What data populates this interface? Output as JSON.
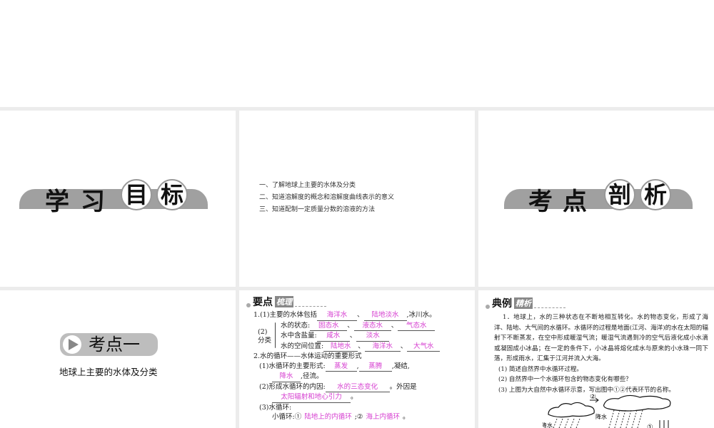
{
  "slides": [
    {
      "title_chars": [
        "学",
        "习",
        "目",
        "标"
      ]
    },
    {
      "goals": [
        "一、了解地球上主要的水体及分类",
        "二、知道溶解度的概念和溶解度曲线表示的意义",
        "三、知道配制一定质量分数的溶液的方法"
      ]
    },
    {
      "title_chars": [
        "考",
        "点",
        "剖",
        "析"
      ]
    },
    {
      "badge": "考点一",
      "subtitle": "地球上主要的水体及分类"
    },
    {
      "header": "要点",
      "header_tag": "梳理",
      "l1a": "1.(1)主要的水体包括",
      "a1": "海洋水",
      "sep": "、",
      "a2": "陆地淡水",
      "l1b": ",冰川水。",
      "cls": "(2)分类",
      "r1": "水的状态:",
      "a3": "固态水",
      "a4": "液态水",
      "a5": "气态水",
      "r2": "水中含盐量:",
      "a6": "咸水",
      "a7": "淡水",
      "r3": "水的空间位置:",
      "a8": "陆地水",
      "a9": "海洋水",
      "a10": "大气水",
      "l2": "2.水的循环——水体运动的重要形式",
      "l3": "(1)水循环的主要形式:",
      "a11": "蒸发",
      "comma": ",",
      "a12": "蒸腾",
      "l3b": ",凝结,",
      "a13": "降水",
      "l3c": ",径流。",
      "l4": "(2)形成水循环的内因:",
      "a14": "水的三态变化",
      "l4b": "。外因是",
      "a15": "太阳辐射和地心引力",
      "period": "。",
      "l5": "(3)水循环:",
      "l6": "小循环:①",
      "a16": "陆地上的内循环",
      "l6b": ";②",
      "a17": "海上内循环"
    },
    {
      "header": "典例",
      "header_tag": "精析",
      "para": "1．地球上，水的三种状态在不断地相互转化。水的物态变化，形成了海洋、陆地、大气间的水循环。水循环的过程是地面(江河、海洋)的水在太阳的辐射下不断蒸发，在空中形成暖湿气流；暖湿气流遇到冷的空气后液化成小水滴或凝固成小冰晶；在一定的条件下，小冰晶将熔化成水与原来的小水珠一同下落，形成雨水，汇集于江河并流入大海。",
      "q1": "(1) 简述自然界中水循环过程。",
      "q2": "(2) 自然界中一个水循环包含的物态变化有哪些？",
      "q3": "(3) 上图为大自然中水循环示意，写出图中①②代表环节的名称。",
      "fig": {
        "label2": "②",
        "label1": "①",
        "rain": "降水"
      }
    }
  ]
}
